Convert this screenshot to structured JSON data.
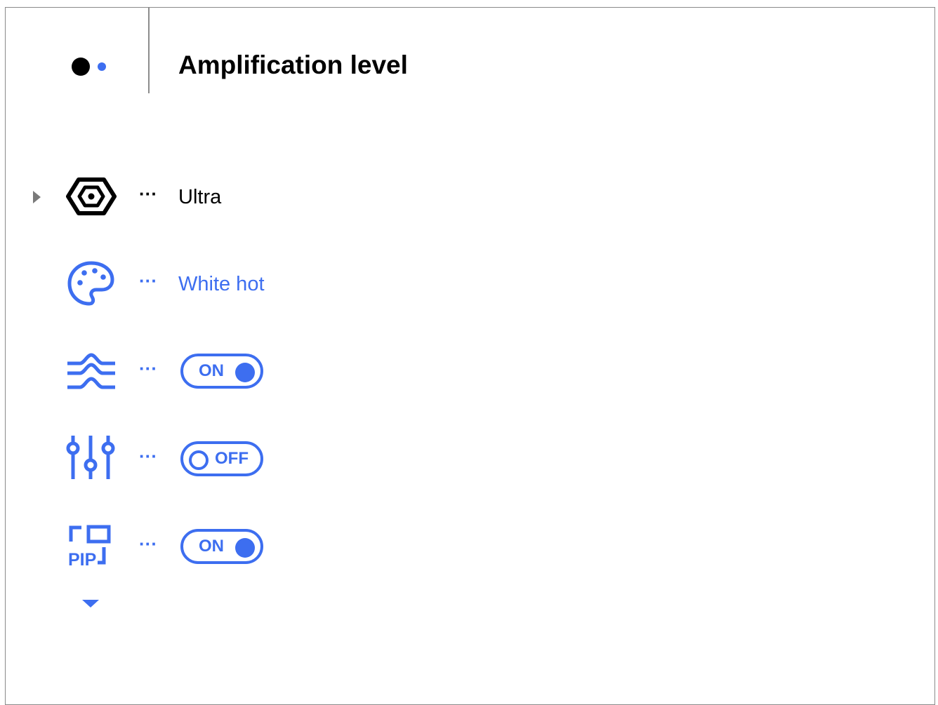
{
  "header": {
    "title": "Amplification level",
    "page_indicator_icon": "page-dots-icon"
  },
  "colors": {
    "accent": "#3d6ef0",
    "text": "#000000",
    "caret": "#7a7a7a"
  },
  "menu": {
    "items": [
      {
        "id": "amplification",
        "icon": "hexagon-nut-icon",
        "selected": true,
        "ellipsis": "···",
        "value": "Ultra"
      },
      {
        "id": "color-palette",
        "icon": "palette-icon",
        "selected": false,
        "ellipsis": "···",
        "value": "White hot"
      },
      {
        "id": "smoothing",
        "icon": "waves-icon",
        "selected": false,
        "ellipsis": "···",
        "toggle": "ON"
      },
      {
        "id": "equalizer",
        "icon": "sliders-icon",
        "selected": false,
        "ellipsis": "···",
        "toggle": "OFF"
      },
      {
        "id": "pip",
        "icon": "pip-icon",
        "icon_text": "PIP",
        "selected": false,
        "ellipsis": "···",
        "toggle": "ON"
      }
    ]
  },
  "more_indicator": "chevron-down-icon"
}
